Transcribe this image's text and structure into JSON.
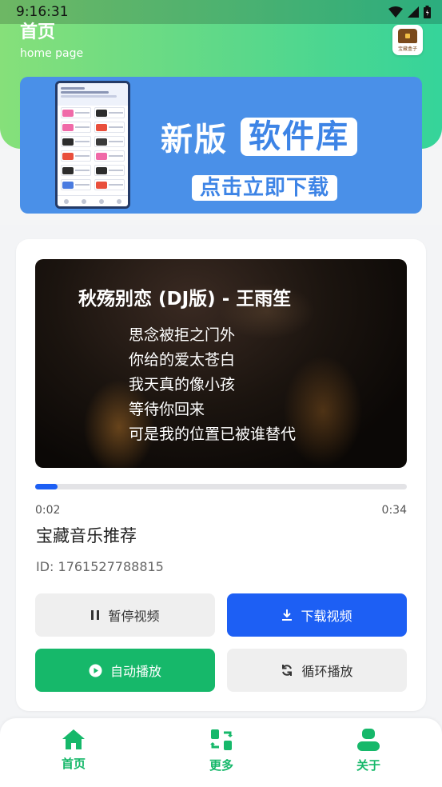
{
  "status_bar": {
    "time": "9:16:31"
  },
  "header": {
    "title": "首页",
    "subtitle": "home page",
    "logo_text": "宝藏盒子"
  },
  "banner": {
    "title_left": "新版",
    "title_right": "软件库",
    "cta": "点击立即下载"
  },
  "player": {
    "video_title": "秋殇别恋 (DJ版) - 王雨笙",
    "lyrics": [
      "思念被拒之门外",
      "你给的爱太苍白",
      "我天真的像小孩",
      "等待你回来",
      "可是我的位置已被谁替代"
    ],
    "progress": 0.06,
    "current_time": "0:02",
    "total_time": "0:34",
    "name": "宝藏音乐推荐",
    "id_text": "ID: 1761527788815"
  },
  "buttons": {
    "pause": "暂停视频",
    "download": "下载视频",
    "autoplay": "自动播放",
    "loop": "循环播放"
  },
  "nav": {
    "home": "首页",
    "more": "更多",
    "about": "关于",
    "active_color": "#16b86a"
  },
  "colors": {
    "primary_blue": "#1d5ff4",
    "green": "#16b86a",
    "banner_blue": "#4a90e8"
  }
}
